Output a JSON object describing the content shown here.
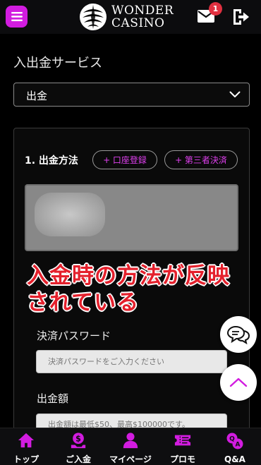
{
  "header": {
    "logo_line1": "WONDER",
    "logo_line2": "CASINO",
    "mail_badge": "1",
    "menu_icon": "hamburger-icon",
    "mail_icon": "mail-icon",
    "exit_icon": "logout-icon"
  },
  "page": {
    "title": "入出金サービス",
    "select_value": "出金"
  },
  "card": {
    "step_label": "1. 出金方法",
    "pill_register": "+ 口座登録",
    "pill_third_party": "+ 第三者決済",
    "annotation_line1": "入金時の方法が反映",
    "annotation_line2": "されている",
    "password_label": "決済パスワード",
    "password_placeholder": "決済パスワードをご入力ください",
    "amount_label": "出金額",
    "amount_placeholder": "出金額は最低$50、最高$100000です。"
  },
  "nav": {
    "items": [
      {
        "label": "トップ",
        "icon": "home-icon"
      },
      {
        "label": "ご入金",
        "icon": "deposit-icon"
      },
      {
        "label": "マイページ",
        "icon": "user-icon"
      },
      {
        "label": "プロモ",
        "icon": "ticket-icon"
      },
      {
        "label": "Q&A",
        "icon": "qa-icon"
      }
    ]
  },
  "colors": {
    "accent": "#d21ce0",
    "annotation": "#e4202c",
    "background": "#000000"
  }
}
